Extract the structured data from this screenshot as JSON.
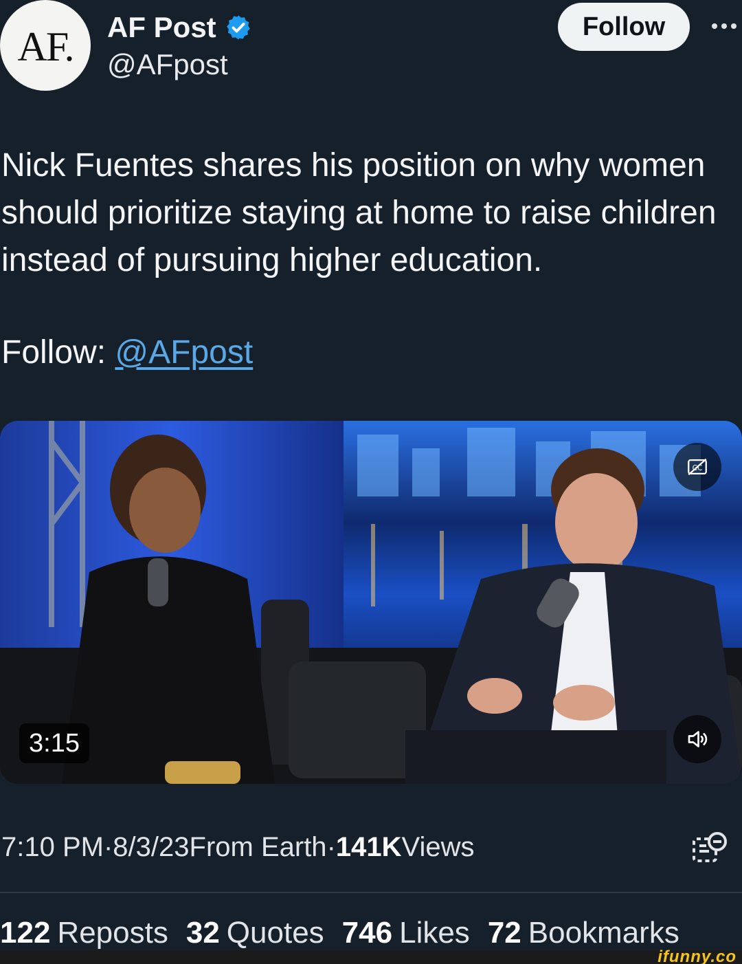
{
  "author": {
    "avatar_text": "AF.",
    "display_name": "AF Post",
    "handle": "@AFpost",
    "verified": true
  },
  "header": {
    "follow_label": "Follow",
    "more_icon": "more-dots-icon"
  },
  "tweet": {
    "text": "Nick Fuentes shares his position on why women should prioritize staying at home to raise children instead of pursuing higher education.",
    "follow_prefix": "Follow: ",
    "follow_link": "@AFpost"
  },
  "video": {
    "duration": "3:15",
    "cc_icon": "closed-captions-icon",
    "sound_icon": "speaker-icon"
  },
  "meta": {
    "time": "7:10 PM",
    "sep1": " · ",
    "date": "8/3/23",
    "source": " From Earth",
    "sep2": " · ",
    "views_count": "141K",
    "views_label": " Views"
  },
  "stats": [
    {
      "count": "122",
      "label": "Reposts"
    },
    {
      "count": "32",
      "label": "Quotes"
    },
    {
      "count": "746",
      "label": "Likes"
    },
    {
      "count": "72",
      "label": "Bookmarks"
    }
  ],
  "watermark": "ifunny.co",
  "colors": {
    "background": "#16202b",
    "link": "#5aa9e6",
    "verified": "#1d9bf0"
  }
}
